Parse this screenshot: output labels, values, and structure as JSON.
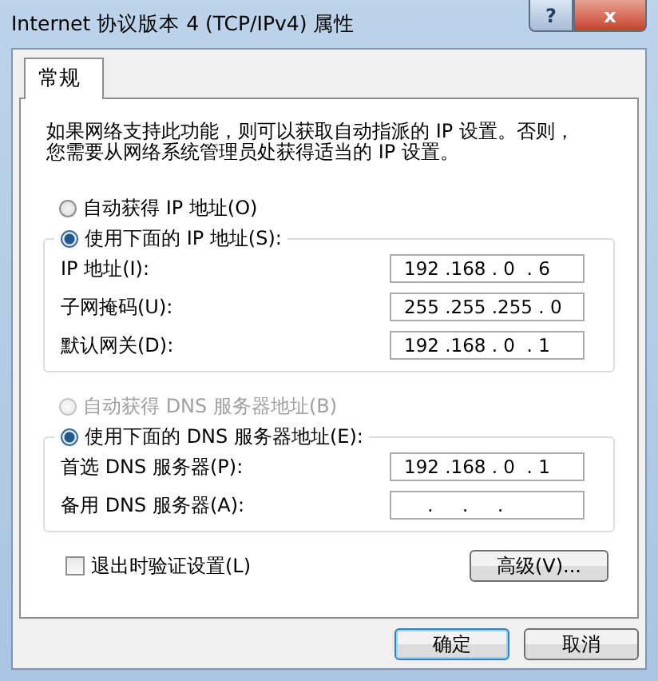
{
  "window": {
    "title": "Internet 协议版本 4 (TCP/IPv4) 属性",
    "help_button": "?",
    "close_button": "x"
  },
  "tabs": [
    {
      "label": "常规",
      "selected": true
    }
  ],
  "description": [
    "如果网络支持此功能，则可以获取自动指派的 IP 设置。否则，",
    "您需要从网络系统管理员处获得适当的 IP 设置。"
  ],
  "ip_section": {
    "auto_option": {
      "label": "自动获得 IP 地址(O)",
      "selected": false,
      "disabled": false
    },
    "manual_option": {
      "label": "使用下面的 IP 地址(S):",
      "selected": true,
      "disabled": false
    },
    "fields": [
      {
        "label": "IP 地址(I):",
        "value": "192 .168 . 0  . 6"
      },
      {
        "label": "子网掩码(U):",
        "value": "255 .255 .255 . 0"
      },
      {
        "label": "默认网关(D):",
        "value": "192 .168 . 0  . 1"
      }
    ]
  },
  "dns_section": {
    "auto_option": {
      "label": "自动获得 DNS 服务器地址(B)",
      "selected": false,
      "disabled": true
    },
    "manual_option": {
      "label": "使用下面的 DNS 服务器地址(E):",
      "selected": true,
      "disabled": false
    },
    "fields": [
      {
        "label": "首选 DNS 服务器(P):",
        "value": "192 .168 . 0  . 1"
      },
      {
        "label": "备用 DNS 服务器(A):",
        "value": "    .     .     ."
      }
    ]
  },
  "validate_checkbox": {
    "label": "退出时验证设置(L)",
    "checked": false
  },
  "advanced_button": "高级(V)...",
  "buttons": [
    {
      "label": "确定",
      "kind": "default"
    },
    {
      "label": "取消",
      "kind": "normal"
    }
  ]
}
